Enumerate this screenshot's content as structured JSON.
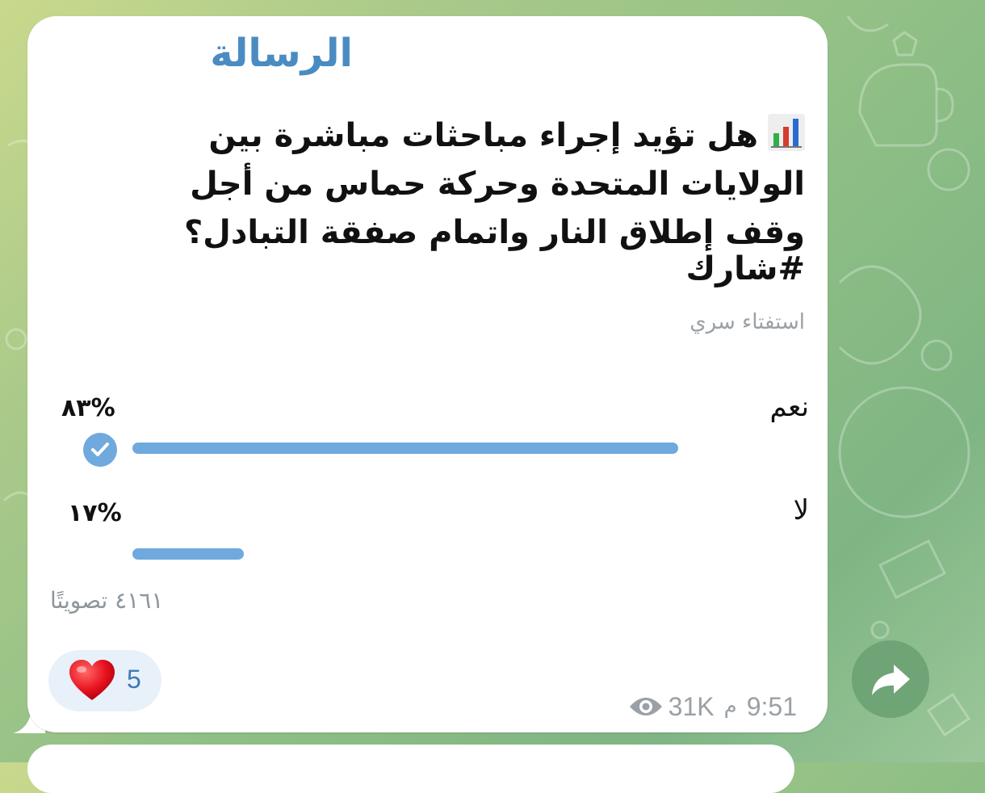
{
  "channel": {
    "name": "الرسالة"
  },
  "poll": {
    "icon": "bar-chart-icon",
    "question": "هل تؤيد إجراء مباحثات مباشرة بين الولايات المتحدة وحركة حماس من أجل وقف إطلاق النار واتمام صفقة التبادل؟",
    "hashtag": "#شارك",
    "type_label": "استفتاء سري",
    "options": [
      {
        "label": "نعم",
        "percent_text": "٨٣%",
        "fraction": 0.83,
        "selected": true
      },
      {
        "label": "لا",
        "percent_text": "١٧%",
        "fraction": 0.17,
        "selected": false
      }
    ],
    "total_votes": "٤١٦١ تصويتًا"
  },
  "reaction": {
    "icon": "heart-icon",
    "count": "5"
  },
  "meta": {
    "time": "9:51",
    "ampm": "م",
    "views": "31K",
    "views_icon": "eye-icon"
  },
  "actions": {
    "share_icon": "share-arrow-icon"
  },
  "colors": {
    "accent": "#6fa9de",
    "channel": "#4a8cc2",
    "share_button": "#6ea476"
  }
}
